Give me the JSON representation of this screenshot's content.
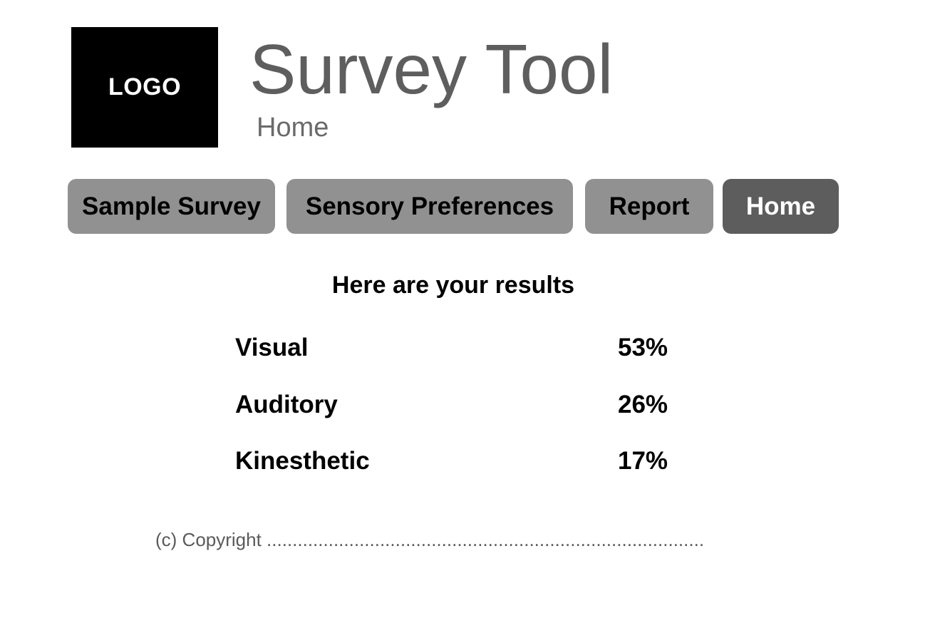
{
  "header": {
    "logo_text": "LOGO",
    "title": "Survey Tool",
    "subtitle": "Home"
  },
  "nav": {
    "items": [
      {
        "label": "Sample Survey",
        "active": false
      },
      {
        "label": "Sensory Preferences",
        "active": false
      },
      {
        "label": "Report",
        "active": false
      },
      {
        "label": "Home",
        "active": true
      }
    ]
  },
  "results": {
    "heading": "Here are your results",
    "rows": [
      {
        "label": "Visual",
        "value": "53%"
      },
      {
        "label": "Auditory",
        "value": "26%"
      },
      {
        "label": "Kinesthetic",
        "value": "17%"
      }
    ]
  },
  "footer": {
    "text": "(c) Copyright ....................................................................................."
  },
  "colors": {
    "logo_bg": "#000000",
    "title_text": "#5e5e5e",
    "nav_button": "#919191",
    "nav_button_active": "#5d5d5d"
  }
}
